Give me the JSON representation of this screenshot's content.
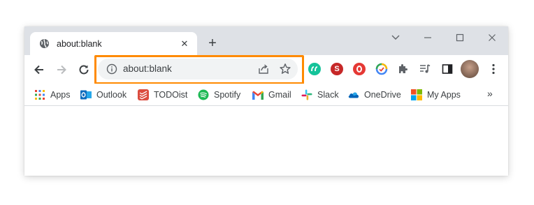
{
  "tab": {
    "title": "about:blank",
    "favicon": "globe-icon",
    "close_glyph": "✕"
  },
  "new_tab_glyph": "+",
  "window_controls": {
    "tab_search": "chevron-down-icon",
    "minimize": "minimize-icon",
    "maximize": "maximize-icon",
    "close": "close-icon"
  },
  "omnibox": {
    "url": "about:blank",
    "left_icon": "info-icon",
    "share_icon": "share-icon",
    "star_icon": "star-icon",
    "highlight_color": "#ff8a00"
  },
  "extensions": [
    {
      "name": "grammarly-icon",
      "color": "#15c39a",
      "glyph": "G"
    },
    {
      "name": "seo-extension-icon",
      "color": "#d32f2f",
      "glyph": "S"
    },
    {
      "name": "opera-vpn-icon",
      "color": "#e53935",
      "glyph": "O"
    },
    {
      "name": "google-one-icon",
      "color": "#4285f4",
      "glyph": "✓"
    }
  ],
  "bookmarks": [
    {
      "label": "Apps",
      "icon": "apps-grid-icon"
    },
    {
      "label": "Outlook",
      "icon": "outlook-icon",
      "color": "#0f6cbd"
    },
    {
      "label": "TODOist",
      "icon": "todoist-icon",
      "color": "#db4c3f"
    },
    {
      "label": "Spotify",
      "icon": "spotify-icon",
      "color": "#1db954"
    },
    {
      "label": "Gmail",
      "icon": "gmail-icon",
      "color": "#ea4335"
    },
    {
      "label": "Slack",
      "icon": "slack-icon",
      "color": "#4a154b"
    },
    {
      "label": "OneDrive",
      "icon": "onedrive-icon",
      "color": "#0364b8"
    },
    {
      "label": "My Apps",
      "icon": "microsoft-icon"
    }
  ],
  "bookmarks_overflow": "»"
}
